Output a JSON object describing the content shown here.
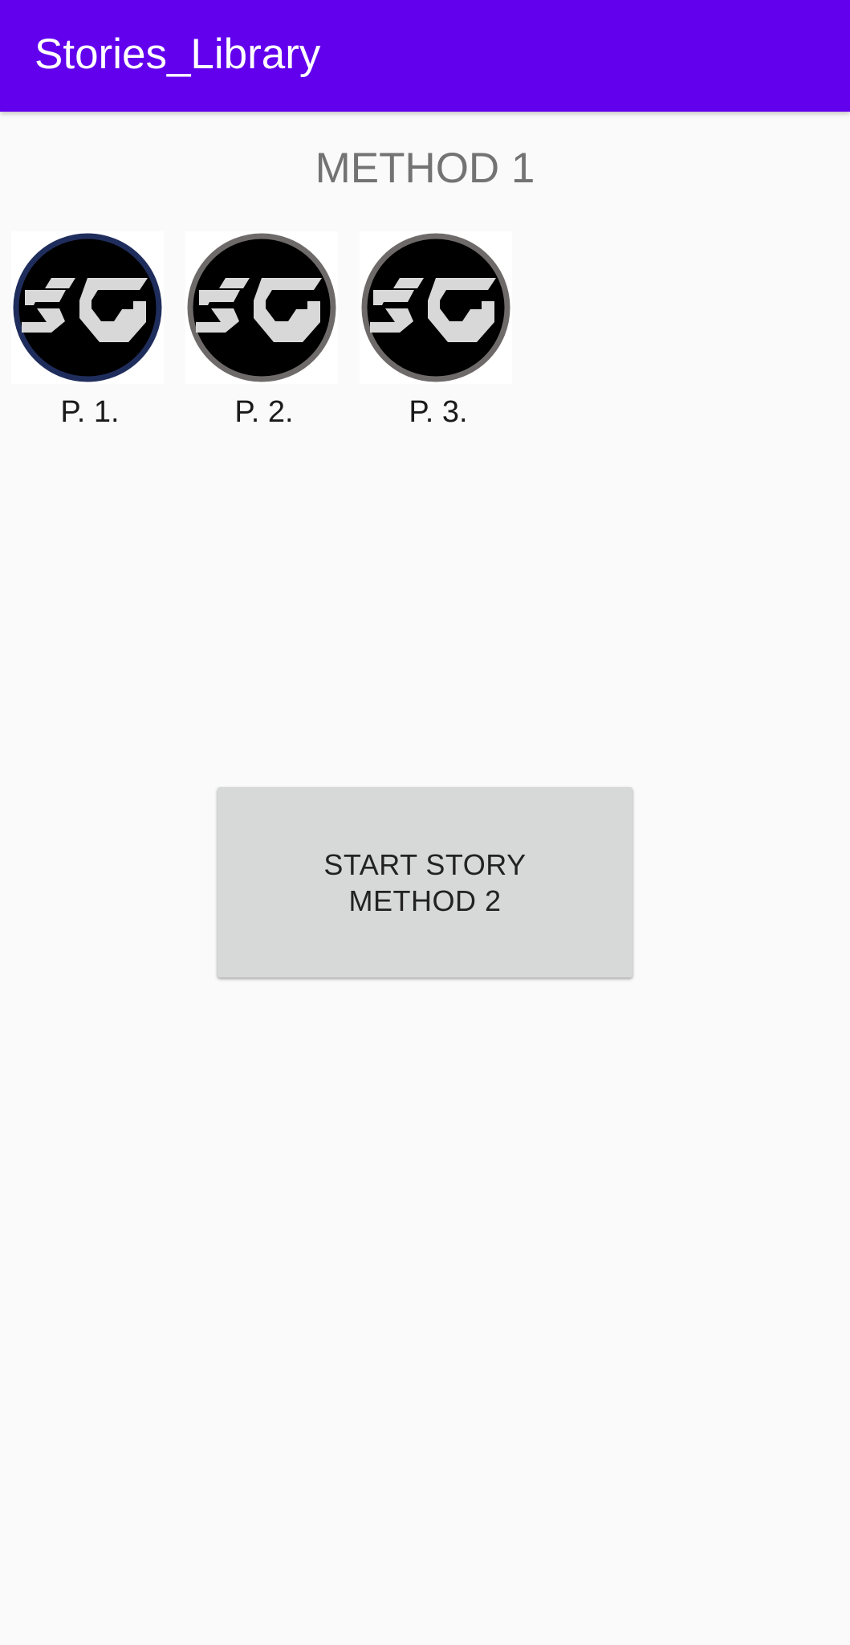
{
  "app_bar": {
    "title": "Stories_Library",
    "color": "#6200ee"
  },
  "method1": {
    "title": "METHOD 1",
    "stories": [
      {
        "label": "P. 1.",
        "icon": "sg-logo-icon",
        "ring_color": "#1f2d5c"
      },
      {
        "label": "P. 2.",
        "icon": "sg-logo-icon",
        "ring_color": "#6f6a6a"
      },
      {
        "label": "P. 3.",
        "icon": "sg-logo-icon",
        "ring_color": "#6f6a6a"
      }
    ]
  },
  "method2": {
    "button_label": "START STORY\nMETHOD 2"
  }
}
